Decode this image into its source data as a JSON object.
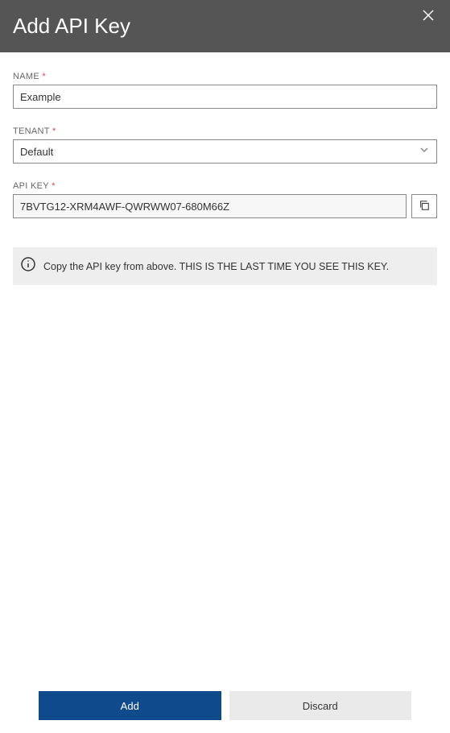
{
  "header": {
    "title": "Add API Key"
  },
  "fields": {
    "name": {
      "label": "NAME",
      "required": "*",
      "value": "Example"
    },
    "tenant": {
      "label": "TENANT",
      "required": "*",
      "value": "Default"
    },
    "apikey": {
      "label": "API KEY",
      "required": "*",
      "value": "7BVTG12-XRM4AWF-QWRWW07-680M66Z"
    }
  },
  "info": {
    "text": "Copy the API key from above. THIS IS THE LAST TIME YOU SEE THIS KEY."
  },
  "footer": {
    "add": "Add",
    "discard": "Discard"
  }
}
